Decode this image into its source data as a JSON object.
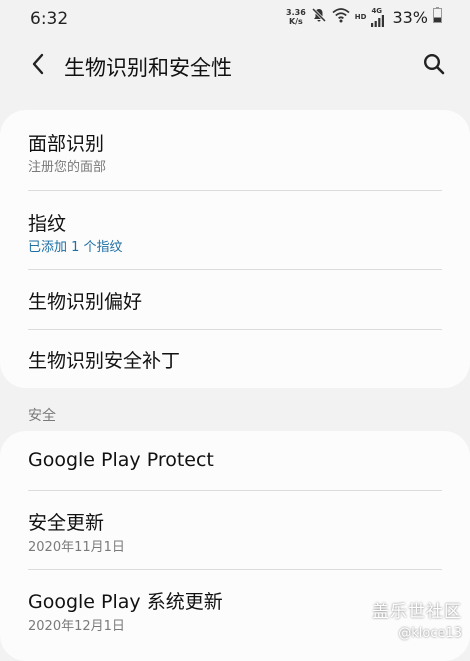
{
  "status_bar": {
    "time": "6:32",
    "speed_value": "3.36",
    "speed_unit": "K/s",
    "network_label": "HD",
    "network_type": "4G",
    "battery": "33%",
    "icons": [
      "mute-icon",
      "wifi-icon",
      "signal-icon",
      "battery-icon"
    ]
  },
  "appbar": {
    "title": "生物识别和安全性",
    "back_icon": "back-arrow-icon",
    "search_icon": "search-icon"
  },
  "biometrics": {
    "items": [
      {
        "title": "面部识别",
        "subtitle": "注册您的面部"
      },
      {
        "title": "指纹",
        "subtitle": "已添加 1 个指纹"
      },
      {
        "title": "生物识别偏好"
      },
      {
        "title": "生物识别安全补丁"
      }
    ]
  },
  "security": {
    "header": "安全",
    "items": [
      {
        "title": "Google Play Protect"
      },
      {
        "title": "安全更新",
        "subtitle": "2020年11月1日"
      },
      {
        "title": "Google Play 系统更新",
        "subtitle": "2020年12月1日"
      }
    ]
  },
  "watermark": {
    "line1": "盖乐世社区",
    "line2": "@kloce13"
  },
  "colors": {
    "background": "#f2f2f2",
    "card": "#fcfcfc",
    "accent": "#1d6fa5",
    "secondary_text": "#7a7a7a"
  }
}
